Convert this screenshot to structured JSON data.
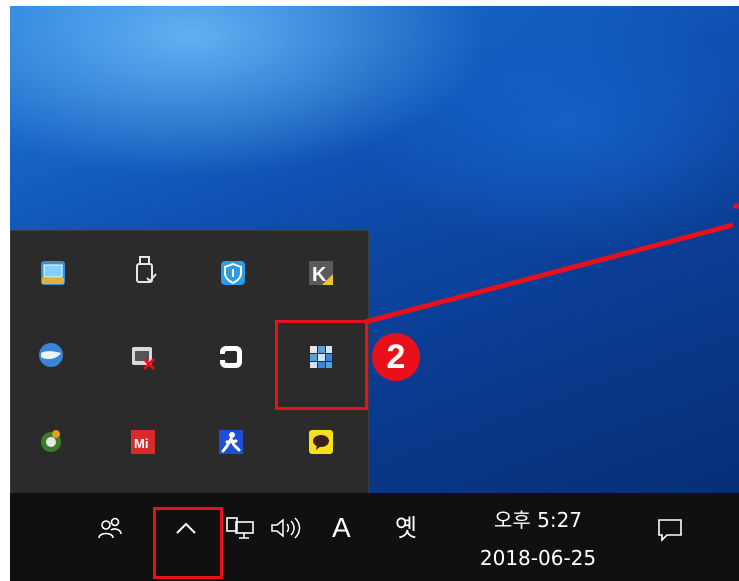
{
  "tray_popup": {
    "icons": [
      {
        "name": "display-settings-icon",
        "color": "#3c8fd6"
      },
      {
        "name": "usb-drive-icon",
        "color": "#e6e6e6"
      },
      {
        "name": "security-shield-icon",
        "color": "#2d9be6"
      },
      {
        "name": "k-app-icon",
        "color": "#555555"
      },
      {
        "name": "globe-icon",
        "color": "#3a86d6"
      },
      {
        "name": "network-error-icon",
        "color": "#d9d9d9"
      },
      {
        "name": "sync-app-icon",
        "color": "#ffffff"
      },
      {
        "name": "grid-app-icon",
        "color": "#5a9fd6"
      },
      {
        "name": "green-ring-icon",
        "color": "#3a7d2a"
      },
      {
        "name": "mi-app-icon",
        "color": "#d62b2b",
        "label": "Mi"
      },
      {
        "name": "running-man-icon",
        "color": "#1e4fd6"
      },
      {
        "name": "kakaotalk-icon",
        "color": "#f6e01c"
      }
    ]
  },
  "taskbar": {
    "people_icon": "people-icon",
    "chevron_icon": "chevron-up-icon",
    "network_icon": "network-icon",
    "volume_icon": "volume-icon",
    "ime_mode": "A",
    "ime_korean": "옛",
    "time": "오후 5:27",
    "date": "2018-06-25",
    "notification_icon": "notification-icon"
  },
  "annotation": {
    "step_number": "2",
    "color": "#e8101a"
  }
}
